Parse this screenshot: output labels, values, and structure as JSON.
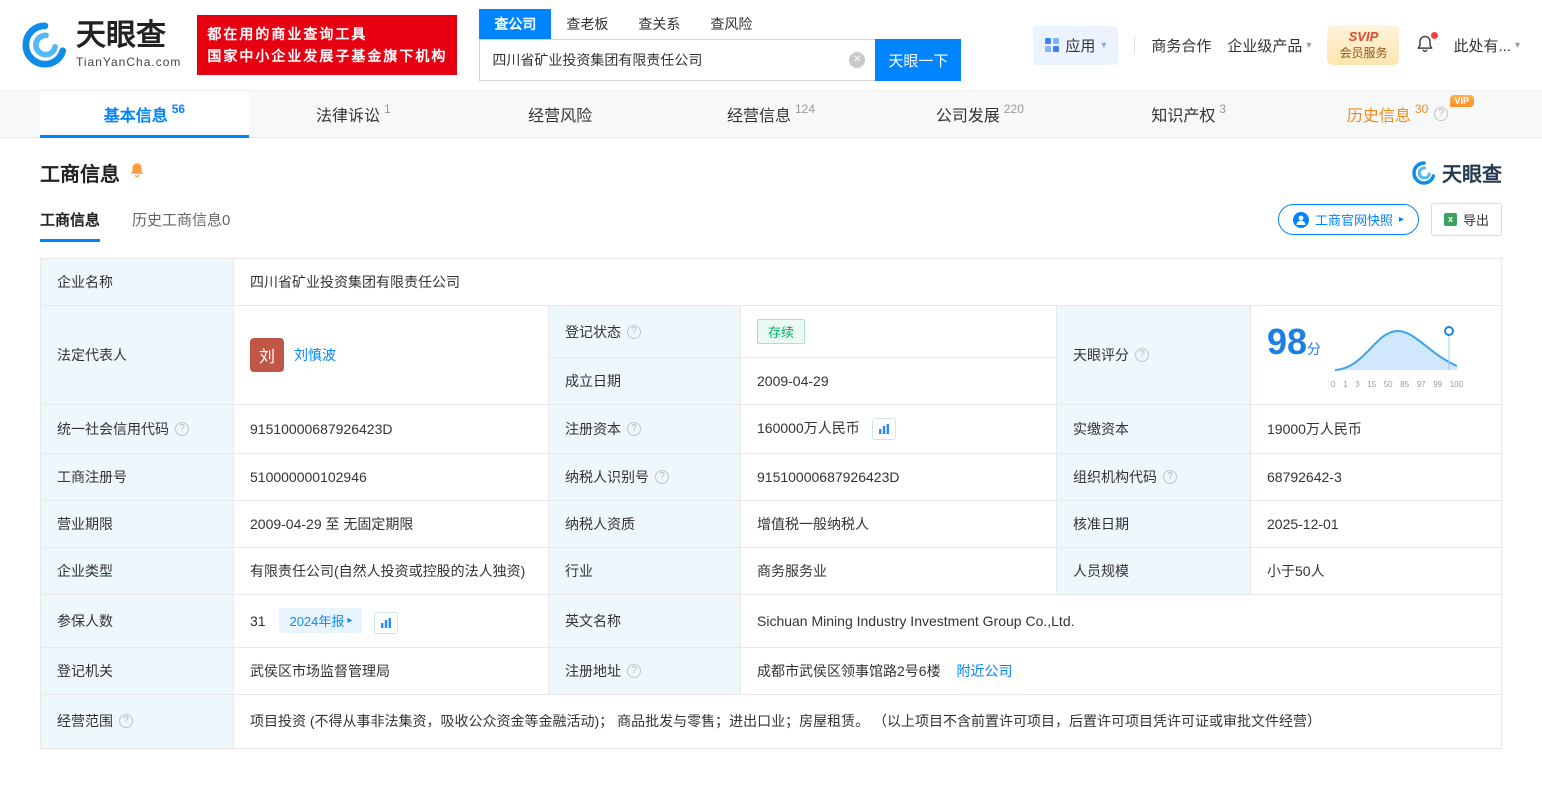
{
  "header": {
    "brand": "天眼查",
    "brand_domain": "TianYanCha.com",
    "promo_line1": "都在用的商业查询工具",
    "promo_line2": "国家中小企业发展子基金旗下机构",
    "search_tabs": [
      {
        "label": "查公司"
      },
      {
        "label": "查老板"
      },
      {
        "label": "查关系"
      },
      {
        "label": "查风险"
      }
    ],
    "search_value": "四川省矿业投资集团有限责任公司",
    "search_button": "天眼一下",
    "app_menu": "应用",
    "biz_coop": "商务合作",
    "enterprise_product": "企业级产品",
    "svip_line1": "SVIP",
    "svip_line2": "会员服务",
    "user_menu": "此处有..."
  },
  "icons": {
    "clear": "✕",
    "caret": "▾",
    "arrow": "▸",
    "help": "?",
    "export_glyph": "x"
  },
  "nav": {
    "tabs": [
      {
        "label": "基本信息",
        "count": "56"
      },
      {
        "label": "法律诉讼",
        "count": "1"
      },
      {
        "label": "经营风险",
        "count": ""
      },
      {
        "label": "经营信息",
        "count": "124"
      },
      {
        "label": "公司发展",
        "count": "220"
      },
      {
        "label": "知识产权",
        "count": "3"
      },
      {
        "label": "历史信息",
        "count": "30",
        "vip": "VIP"
      }
    ]
  },
  "section": {
    "title": "工商信息",
    "watermark_brand": "天眼查",
    "tab_current": "工商信息",
    "tab_history": "历史工商信息",
    "tab_history_count": "0",
    "snapshot_button": "工商官网快照",
    "export_button": "导出"
  },
  "table": {
    "company_name_label": "企业名称",
    "company_name": "四川省矿业投资集团有限责任公司",
    "legal_rep_label": "法定代表人",
    "legal_rep_avatar": "刘",
    "legal_rep_name": "刘慎波",
    "reg_status_label": "登记状态",
    "reg_status": "存续",
    "establish_label": "成立日期",
    "establish_date": "2009-04-29",
    "score_label": "天眼评分",
    "score_value": "98",
    "score_unit": "分",
    "score_axis": [
      "0",
      "1",
      "3",
      "15",
      "50",
      "85",
      "97",
      "99",
      "100"
    ],
    "credit_code_label": "统一社会信用代码",
    "credit_code": "91510000687926423D",
    "reg_capital_label": "注册资本",
    "reg_capital": "160000万人民币",
    "paid_capital_label": "实缴资本",
    "paid_capital": "19000万人民币",
    "reg_number_label": "工商注册号",
    "reg_number": "510000000102946",
    "taxpayer_id_label": "纳税人识别号",
    "taxpayer_id": "91510000687926423D",
    "org_code_label": "组织机构代码",
    "org_code": "68792642-3",
    "business_term_label": "营业期限",
    "business_term": "2009-04-29 至 无固定期限",
    "taxpayer_quality_label": "纳税人资质",
    "taxpayer_quality": "增值税一般纳税人",
    "approval_date_label": "核准日期",
    "approval_date": "2025-12-01",
    "company_type_label": "企业类型",
    "company_type": "有限责任公司(自然人投资或控股的法人独资)",
    "industry_label": "行业",
    "industry": "商务服务业",
    "staff_size_label": "人员规模",
    "staff_size": "小于50人",
    "insured_label": "参保人数",
    "insured_count": "31",
    "insured_badge": "2024年报",
    "english_name_label": "英文名称",
    "english_name": "Sichuan Mining Industry Investment Group Co.,Ltd.",
    "reg_authority_label": "登记机关",
    "reg_authority": "武侯区市场监督管理局",
    "address_label": "注册地址",
    "address": "成都市武侯区领事馆路2号6楼",
    "nearby_link": "附近公司",
    "business_scope_label": "经营范围",
    "business_scope": "项目投资 (不得从事非法集资，吸收公众资金等金融活动)； 商品批发与零售；进出口业；房屋租赁。 （以上项目不含前置许可项目，后置许可项目凭许可证或审批文件经营）"
  },
  "colors": {
    "brand_blue": "#0084ff",
    "promo_red": "#e60012",
    "status_green": "#00b365",
    "history_orange": "#f08a1d",
    "label_bg": "#eef7fc"
  }
}
